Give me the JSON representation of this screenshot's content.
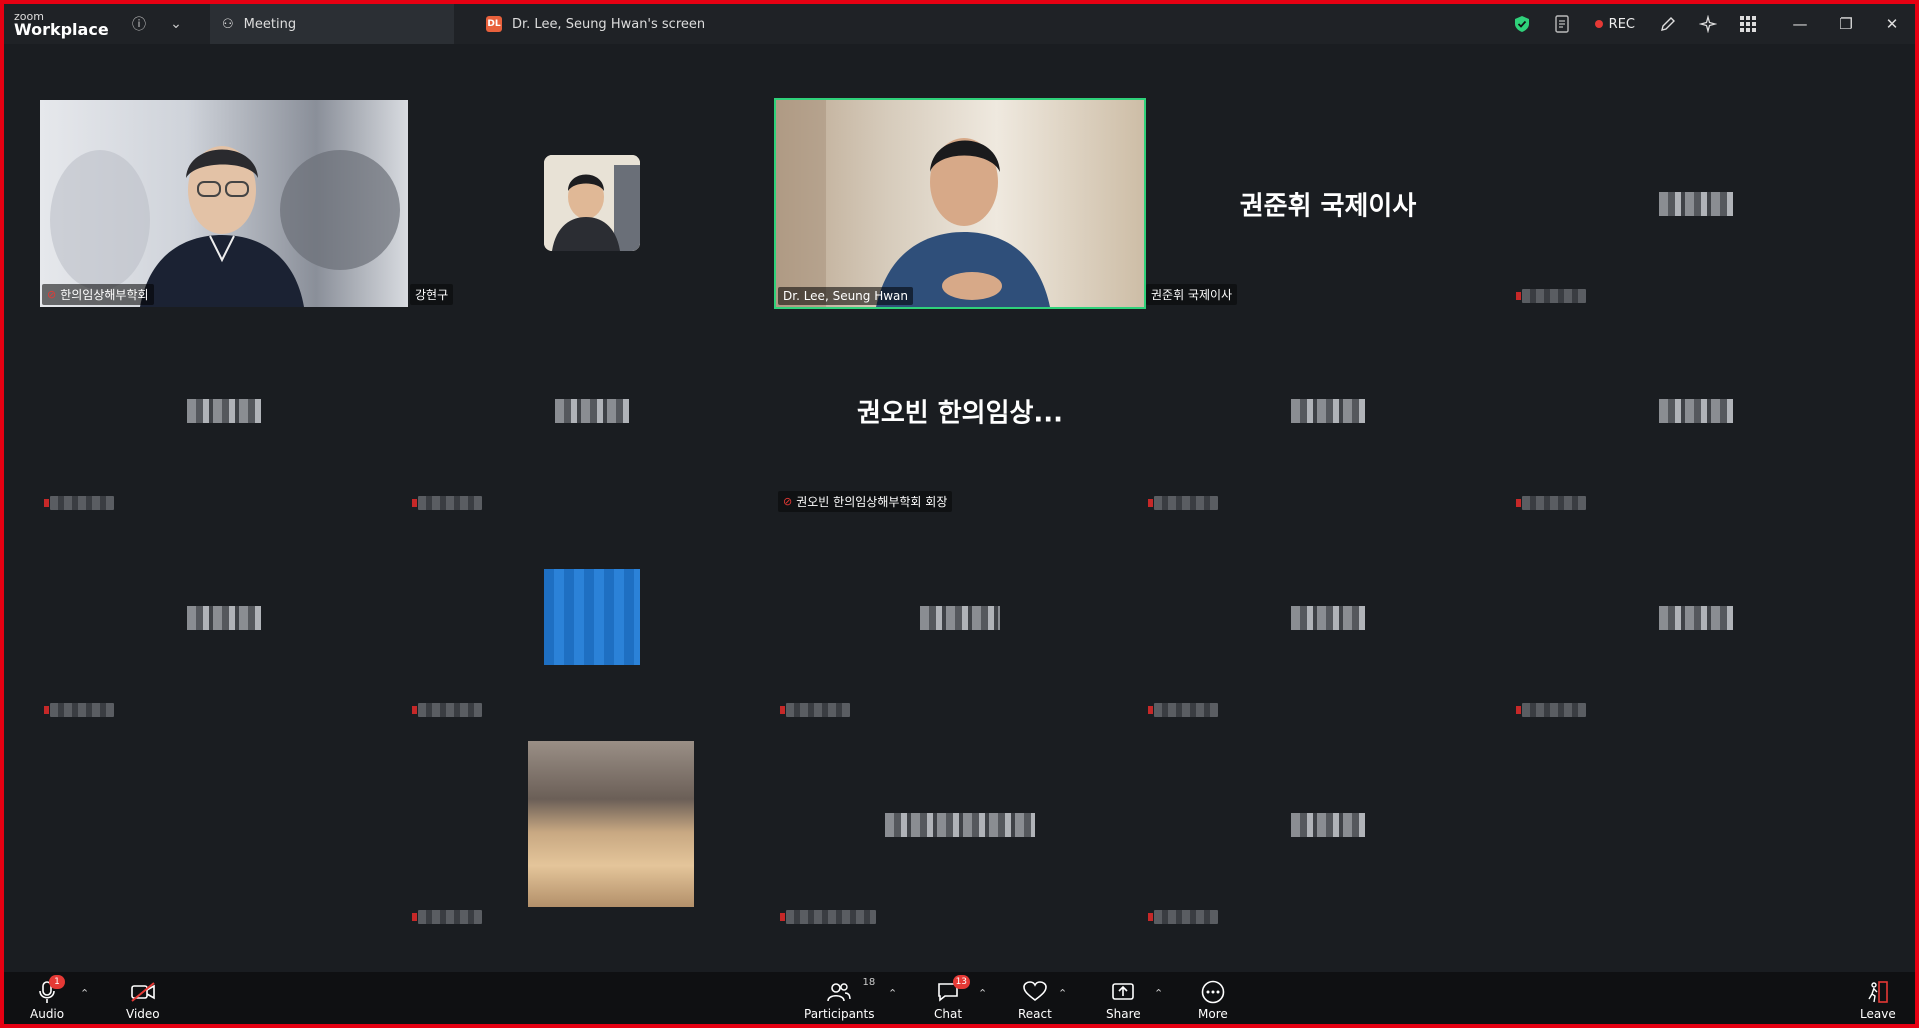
{
  "app": {
    "logo_top": "zoom",
    "logo_bottom": "Workplace"
  },
  "tabs": [
    {
      "label": "Meeting"
    },
    {
      "label": "Dr. Lee, Seung Hwan's screen",
      "badge": "DL"
    }
  ],
  "recording": {
    "label": "REC"
  },
  "tiles": [
    {
      "name": "한의임상해부학회",
      "muted": true
    },
    {
      "name": "강현구"
    },
    {
      "name": "Dr. Lee, Seung Hwan"
    },
    {
      "name": "권준휘 국제이사",
      "display": "권준휘 국제이사"
    },
    {
      "name": "권오빈 한의임상해부학회 회장",
      "display": "권오빈 한의임상...",
      "muted": true
    }
  ],
  "toolbar": {
    "audio": "Audio",
    "video": "Video",
    "participants": "Participants",
    "participants_count": "18",
    "chat": "Chat",
    "chat_badge": "13",
    "audio_badge": "1",
    "react": "React",
    "share": "Share",
    "more": "More",
    "leave": "Leave"
  },
  "colors": {
    "accent_active": "#2fd17a",
    "record": "#e53935",
    "border": "#e60012"
  }
}
